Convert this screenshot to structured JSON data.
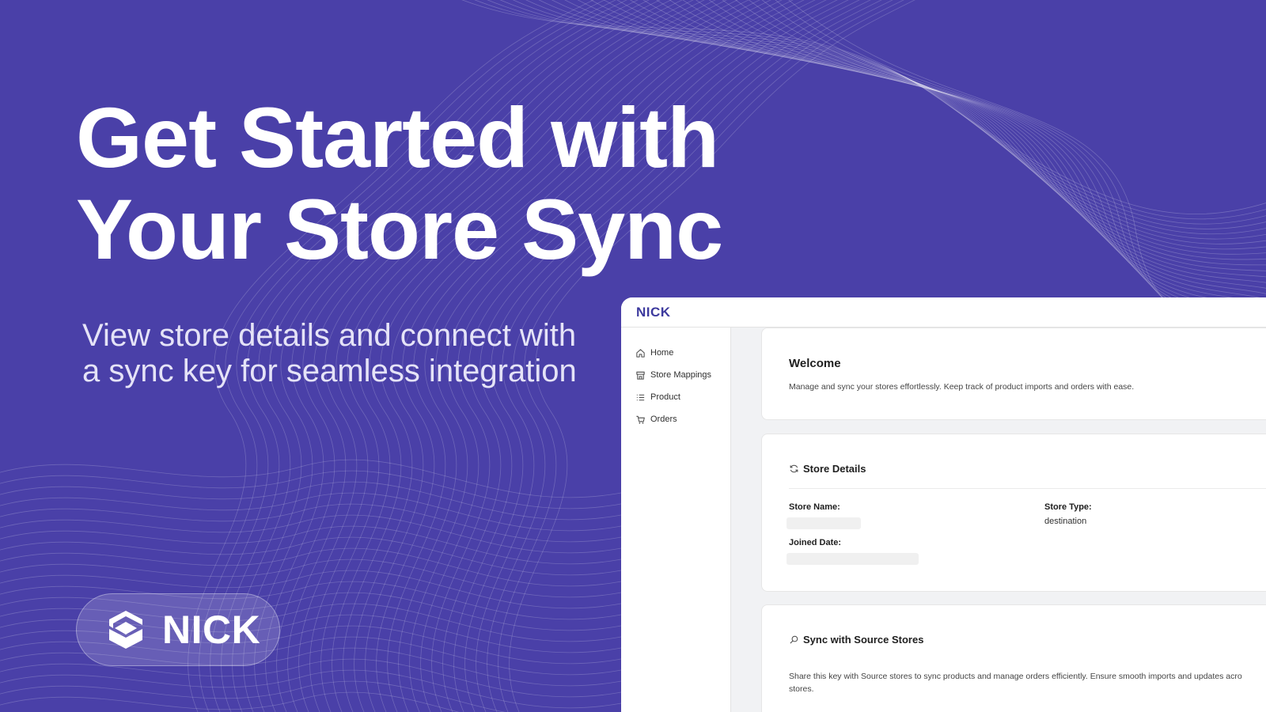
{
  "hero": {
    "headline_line1": "Get Started with",
    "headline_line2": "Your Store Sync",
    "subline_line1": "View store details and connect with",
    "subline_line2": "a sync key for seamless integration"
  },
  "brand": {
    "logo_icon": "shield-cube-icon",
    "name": "NICK"
  },
  "colors": {
    "background": "#4a40a8",
    "app_logo": "#3d3a9e"
  },
  "app": {
    "logo": "NICK",
    "sidebar": {
      "items": [
        {
          "label": "Home",
          "icon": "home-icon"
        },
        {
          "label": "Store Mappings",
          "icon": "store-icon"
        },
        {
          "label": "Product",
          "icon": "list-icon"
        },
        {
          "label": "Orders",
          "icon": "cart-icon"
        }
      ]
    },
    "welcome": {
      "title": "Welcome",
      "text": "Manage and sync your stores effortlessly. Keep track of product imports and orders with ease."
    },
    "store_details": {
      "title": "Store Details",
      "icon": "refresh-icon",
      "store_name_label": "Store Name:",
      "store_type_label": "Store Type:",
      "store_type_value": "destination",
      "joined_date_label": "Joined Date:"
    },
    "sync": {
      "title": "Sync with Source Stores",
      "icon": "search-icon",
      "text_line1": "Share this key with Source stores to sync products and manage orders efficiently. Ensure smooth imports and updates acro",
      "text_line2": "stores."
    }
  }
}
